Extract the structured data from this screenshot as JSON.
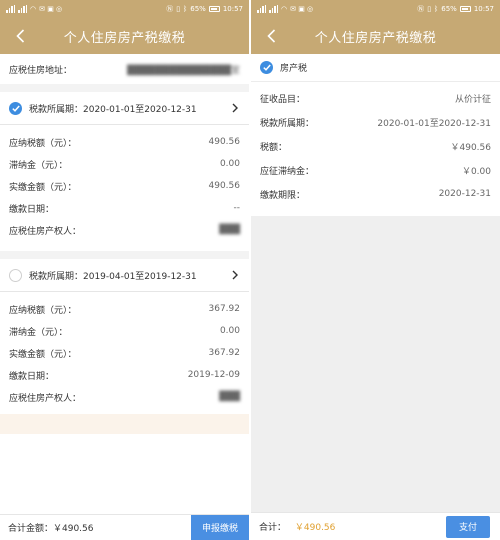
{
  "status": {
    "battery": "65%",
    "time": "10:57"
  },
  "left": {
    "title": "个人住房房产税缴税",
    "address": {
      "label": "应税住房地址：",
      "value": "███████████████室"
    },
    "periods": [
      {
        "selected": true,
        "label": "税款所属期：2020-01-01至2020-12-31",
        "rows": [
          {
            "label": "应纳税额（元）：",
            "value": "490.56",
            "blur": false
          },
          {
            "label": "滞纳金（元）：",
            "value": "0.00",
            "blur": false
          },
          {
            "label": "实缴金额（元）：",
            "value": "490.56",
            "blur": false
          },
          {
            "label": "缴款日期：",
            "value": "--",
            "blur": false
          },
          {
            "label": "应税住房产权人：",
            "value": "███",
            "blur": true
          }
        ]
      },
      {
        "selected": false,
        "label": "税款所属期：2019-04-01至2019-12-31",
        "rows": [
          {
            "label": "应纳税额（元）：",
            "value": "367.92",
            "blur": false
          },
          {
            "label": "滞纳金（元）：",
            "value": "0.00",
            "blur": false
          },
          {
            "label": "实缴金额（元）：",
            "value": "367.92",
            "blur": false
          },
          {
            "label": "缴款日期：",
            "value": "2019-12-09",
            "blur": false
          },
          {
            "label": "应税住房产权人：",
            "value": "███",
            "blur": true
          }
        ]
      }
    ],
    "footer": {
      "total_label": "合计金额：￥490.56",
      "submit_label": "申报缴税"
    }
  },
  "right": {
    "title": "个人住房房产税缴税",
    "tax_name": "房产税",
    "rows": [
      {
        "label": "征收品目：",
        "value": "从价计征"
      },
      {
        "label": "税款所属期：",
        "value": "2020-01-01至2020-12-31"
      },
      {
        "label": "税额：",
        "value": "￥490.56"
      },
      {
        "label": "应征滞纳金：",
        "value": "￥0.00"
      },
      {
        "label": "缴款期限：",
        "value": "2020-12-31"
      }
    ],
    "footer": {
      "total_label": "合计：",
      "total_value": "￥490.56",
      "pay_label": "支付"
    }
  },
  "colors": {
    "header": "#c6a974",
    "accent_blue": "#4a8fe2",
    "check_blue": "#3d8de0",
    "amount_orange": "#e0a030"
  }
}
